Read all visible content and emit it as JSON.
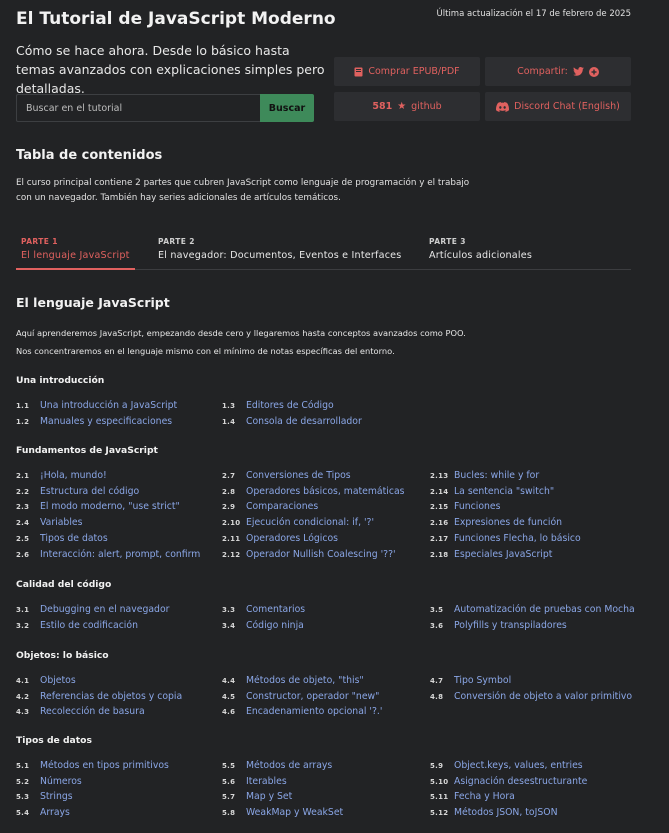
{
  "header": {
    "updated": "Última actualización el 17 de febrero de 2025",
    "title": "El Tutorial de JavaScript Moderno",
    "tagline": "Cómo se hace ahora. Desde lo básico hasta temas avanzados con explicaciones simples pero detalladas.",
    "search": {
      "placeholder": "Buscar en el tutorial",
      "button": "Buscar"
    },
    "buttons": {
      "buy": "Comprar EPUB/PDF",
      "share": "Compartir:",
      "github_count": "581",
      "github_label": "github",
      "discord": "Discord Chat (English)"
    }
  },
  "toc": {
    "title": "Tabla de contenidos",
    "description": "El curso principal contiene 2 partes que cubren JavaScript como lenguaje de programación y el trabajo con un navegador. También hay series adicionales de artículos temáticos.",
    "tabs": [
      {
        "num": "PARTE 1",
        "label": "El lenguaje JavaScript"
      },
      {
        "num": "PARTE 2",
        "label": "El navegador: Documentos, Eventos e Interfaces"
      },
      {
        "num": "PARTE 3",
        "label": "Artículos adicionales"
      }
    ]
  },
  "section": {
    "title": "El lenguaje JavaScript",
    "desc1": "Aquí aprenderemos JavaScript, empezando desde cero y llegaremos hasta conceptos avanzados como POO.",
    "desc2": "Nos concentraremos en el lenguaje mismo con el mínimo de notas específicas del entorno."
  },
  "categories": [
    {
      "title": "Una introducción",
      "columns": [
        [
          [
            "1.1",
            "Una introducción a JavaScript"
          ],
          [
            "1.2",
            "Manuales y especificaciones"
          ]
        ],
        [
          [
            "1.3",
            "Editores de Código"
          ],
          [
            "1.4",
            "Consola de desarrollador"
          ]
        ],
        []
      ]
    },
    {
      "title": "Fundamentos de JavaScript",
      "columns": [
        [
          [
            "2.1",
            "¡Hola, mundo!"
          ],
          [
            "2.2",
            "Estructura del código"
          ],
          [
            "2.3",
            "El modo moderno, \"use strict\""
          ],
          [
            "2.4",
            "Variables"
          ],
          [
            "2.5",
            "Tipos de datos"
          ],
          [
            "2.6",
            "Interacción: alert, prompt, confirm"
          ]
        ],
        [
          [
            "2.7",
            "Conversiones de Tipos"
          ],
          [
            "2.8",
            "Operadores básicos, matemáticas"
          ],
          [
            "2.9",
            "Comparaciones"
          ],
          [
            "2.10",
            "Ejecución condicional: if, '?'"
          ],
          [
            "2.11",
            "Operadores Lógicos"
          ],
          [
            "2.12",
            "Operador Nullish Coalescing '??'"
          ]
        ],
        [
          [
            "2.13",
            "Bucles: while y for"
          ],
          [
            "2.14",
            "La sentencia \"switch\""
          ],
          [
            "2.15",
            "Funciones"
          ],
          [
            "2.16",
            "Expresiones de función"
          ],
          [
            "2.17",
            "Funciones Flecha, lo básico"
          ],
          [
            "2.18",
            "Especiales JavaScript"
          ]
        ]
      ]
    },
    {
      "title": "Calidad del código",
      "columns": [
        [
          [
            "3.1",
            "Debugging en el navegador"
          ],
          [
            "3.2",
            "Estilo de codificación"
          ]
        ],
        [
          [
            "3.3",
            "Comentarios"
          ],
          [
            "3.4",
            "Código ninja"
          ]
        ],
        [
          [
            "3.5",
            "Automatización de pruebas con Mocha"
          ],
          [
            "3.6",
            "Polyfills y transpiladores"
          ]
        ]
      ]
    },
    {
      "title": "Objetos: lo básico",
      "columns": [
        [
          [
            "4.1",
            "Objetos"
          ],
          [
            "4.2",
            "Referencias de objetos y copia"
          ],
          [
            "4.3",
            "Recolección de basura"
          ]
        ],
        [
          [
            "4.4",
            "Métodos de objeto, \"this\""
          ],
          [
            "4.5",
            "Constructor, operador \"new\""
          ],
          [
            "4.6",
            "Encadenamiento opcional '?.'"
          ]
        ],
        [
          [
            "4.7",
            "Tipo Symbol"
          ],
          [
            "4.8",
            "Conversión de objeto a valor primitivo"
          ]
        ]
      ]
    },
    {
      "title": "Tipos de datos",
      "columns": [
        [
          [
            "5.1",
            "Métodos en tipos primitivos"
          ],
          [
            "5.2",
            "Números"
          ],
          [
            "5.3",
            "Strings"
          ],
          [
            "5.4",
            "Arrays"
          ]
        ],
        [
          [
            "5.5",
            "Métodos de arrays"
          ],
          [
            "5.6",
            "Iterables"
          ],
          [
            "5.7",
            "Map y Set"
          ],
          [
            "5.8",
            "WeakMap y WeakSet"
          ]
        ],
        [
          [
            "5.9",
            "Object.keys, values, entries"
          ],
          [
            "5.10",
            "Asignación desestructurante"
          ],
          [
            "5.11",
            "Fecha y Hora"
          ],
          [
            "5.12",
            "Métodos JSON, toJSON"
          ]
        ]
      ]
    }
  ]
}
